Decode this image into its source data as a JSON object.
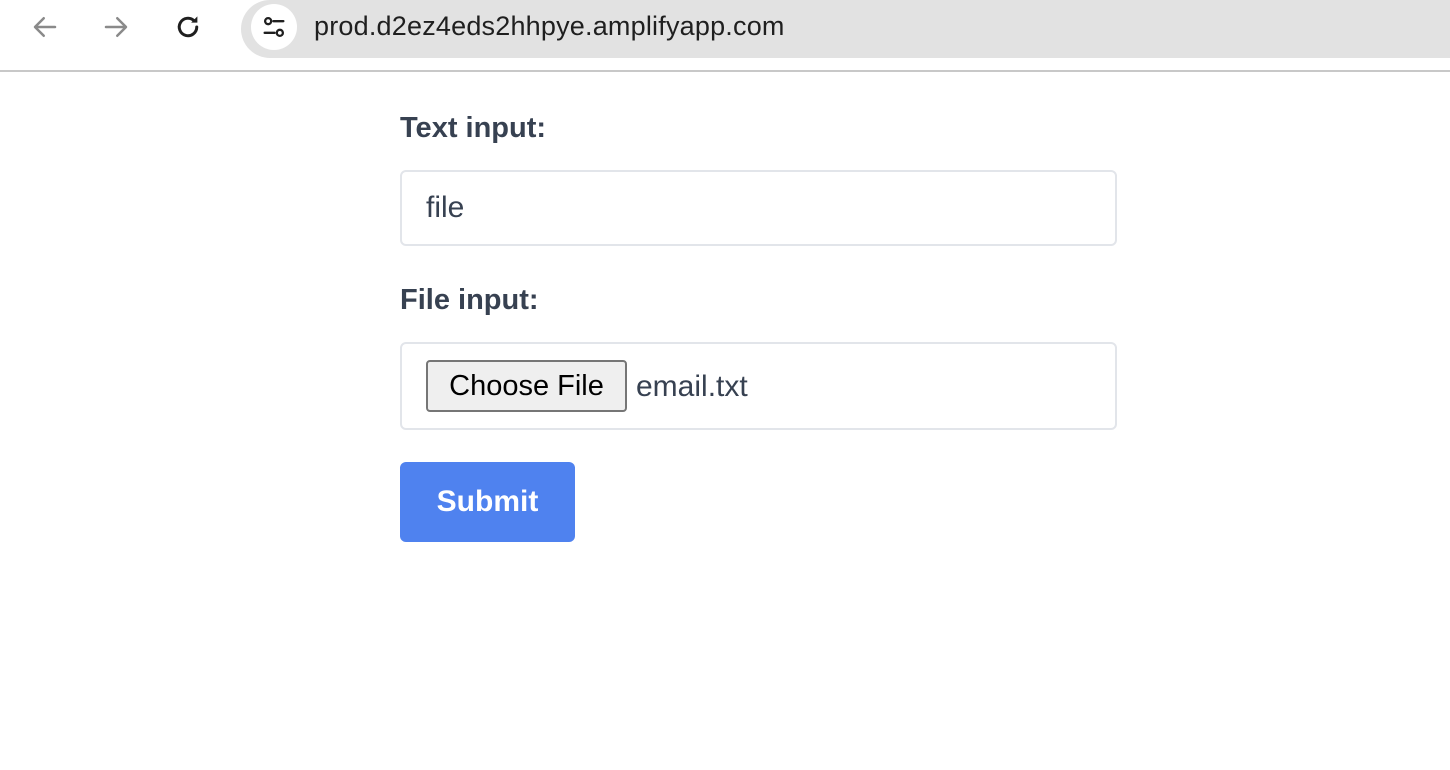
{
  "browser": {
    "url": "prod.d2ez4eds2hhpye.amplifyapp.com",
    "icons": {
      "back": "back-arrow-icon",
      "forward": "forward-arrow-icon",
      "reload": "reload-icon",
      "site_info": "site-settings-icon"
    }
  },
  "form": {
    "text_label": "Text input:",
    "text_value": "file",
    "file_label": "File input:",
    "choose_file_label": "Choose File",
    "file_name": "email.txt",
    "submit_label": "Submit"
  },
  "colors": {
    "accent": "#4f82ef",
    "label_text": "#374151",
    "omnibox_bg": "#e2e2e2"
  }
}
